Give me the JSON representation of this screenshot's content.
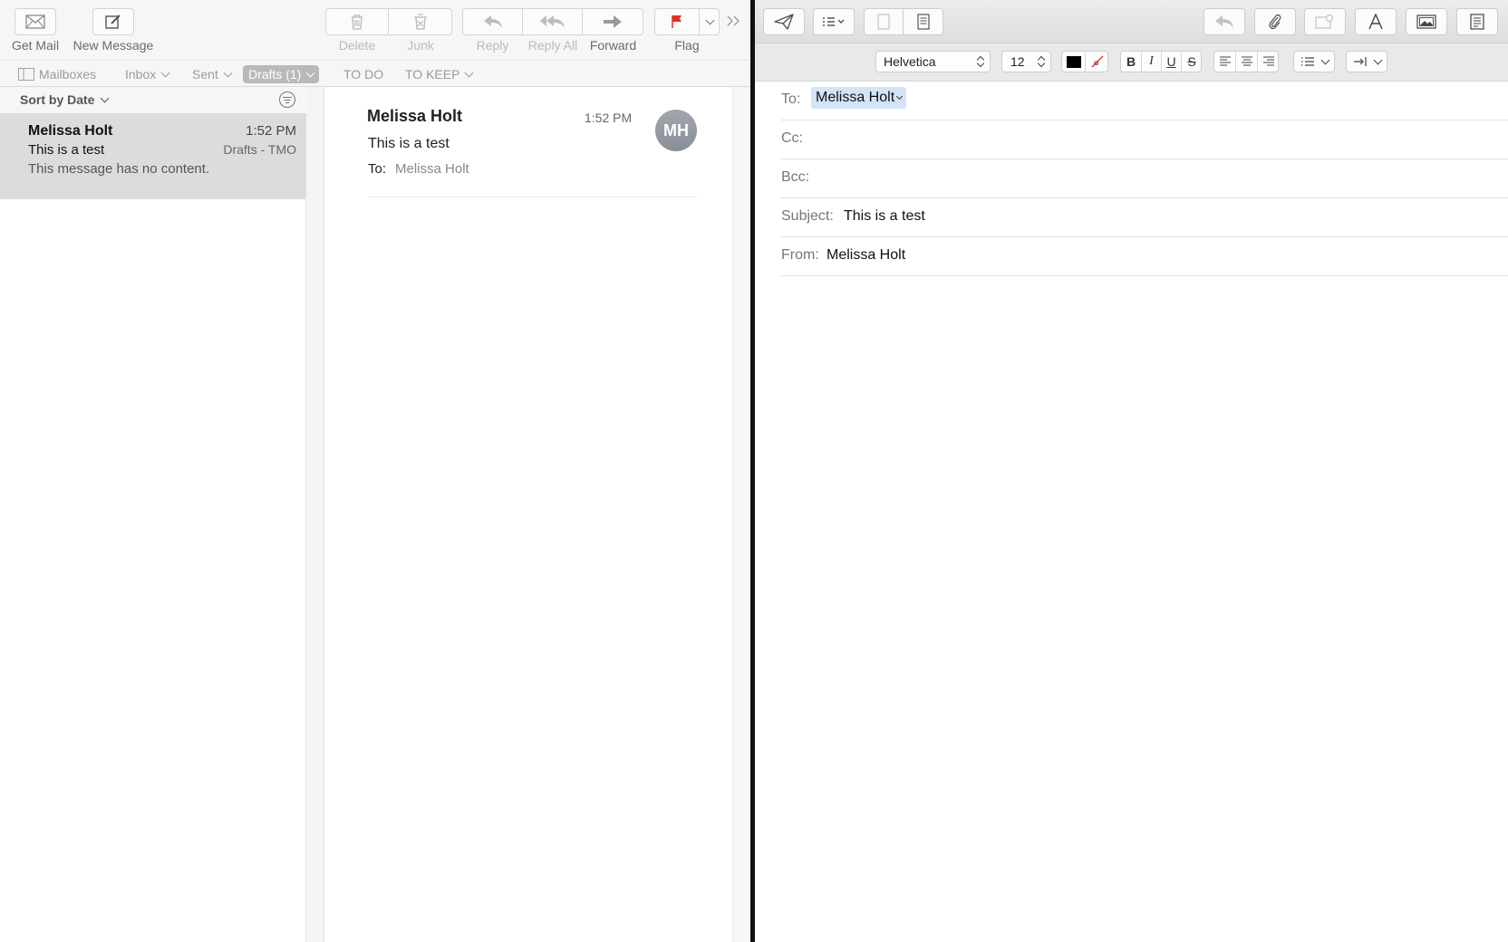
{
  "viewer": {
    "toolbar": {
      "get_mail": "Get Mail",
      "new_message": "New Message",
      "delete": "Delete",
      "junk": "Junk",
      "reply": "Reply",
      "reply_all": "Reply All",
      "forward": "Forward",
      "flag": "Flag"
    },
    "favorites": {
      "mailboxes": "Mailboxes",
      "inbox": "Inbox",
      "sent": "Sent",
      "drafts": "Drafts (1)",
      "todo": "TO DO",
      "to_keep": "TO KEEP"
    },
    "list": {
      "sort_label": "Sort by Date",
      "messages": [
        {
          "from": "Melissa Holt",
          "time": "1:52 PM",
          "subject": "This is a test",
          "mailbox": "Drafts - TMO",
          "preview": "This message has no content."
        }
      ]
    },
    "reader": {
      "from": "Melissa Holt",
      "time": "1:52 PM",
      "avatar_initials": "MH",
      "subject": "This is a test",
      "to_label": "To:",
      "to_value": "Melissa Holt"
    }
  },
  "compose": {
    "format": {
      "font": "Helvetica",
      "size": "12",
      "bold": "B",
      "italic": "I",
      "underline": "U",
      "strike": "S"
    },
    "fields": {
      "to_label": "To:",
      "to_value": "Melissa Holt",
      "cc_label": "Cc:",
      "bcc_label": "Bcc:",
      "subject_label": "Subject:",
      "subject_value": "This is a test",
      "from_label": "From:",
      "from_value": "Melissa Holt"
    }
  },
  "colors": {
    "selection_row": "#dcdcdc",
    "token_bg": "#d3e4f7",
    "flag_red": "#e0302a",
    "avatar_gray": "#9094a0"
  }
}
